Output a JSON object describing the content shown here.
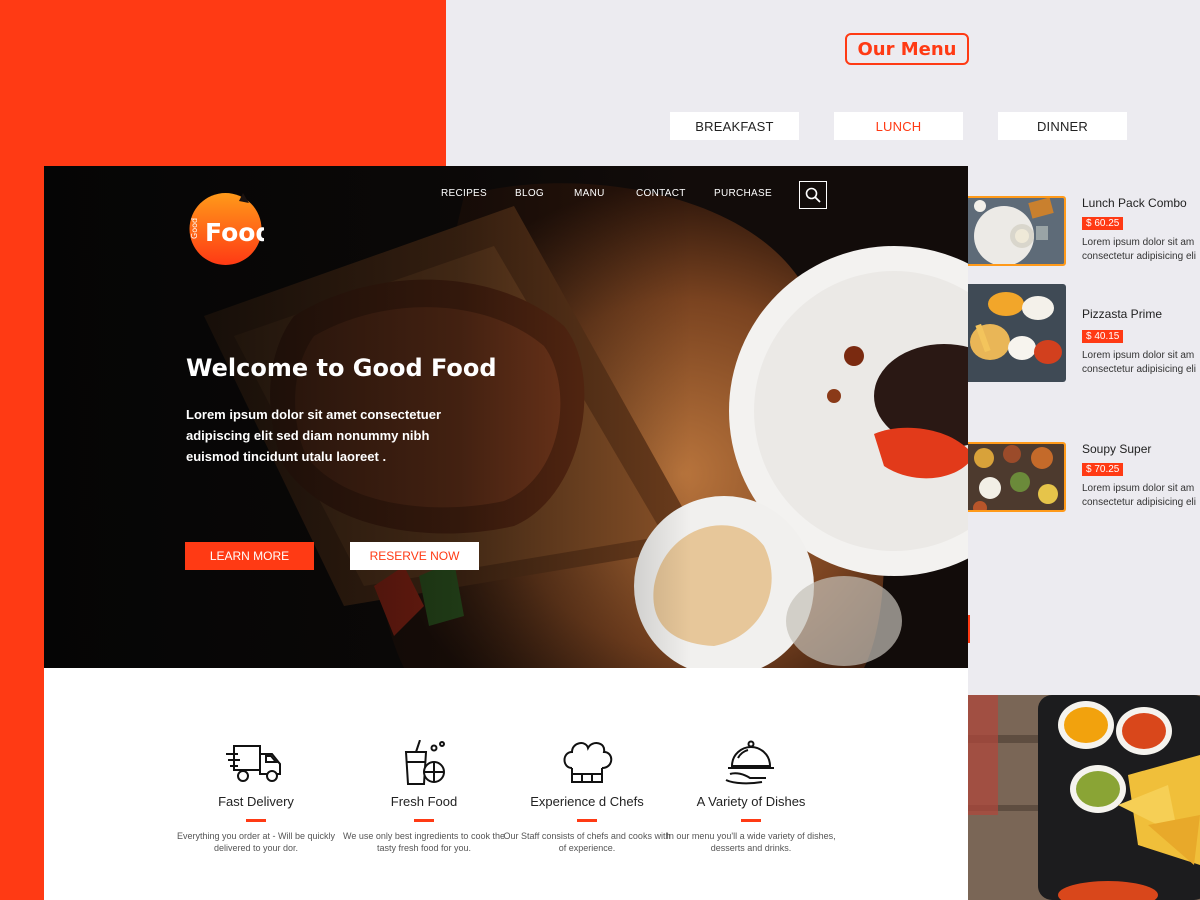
{
  "menu_section": {
    "title": "Our Menu",
    "tabs": [
      {
        "label": "BREAKFAST",
        "active": false
      },
      {
        "label": "LUNCH",
        "active": true
      },
      {
        "label": "DINNER",
        "active": false
      }
    ],
    "items": [
      {
        "name": "Lunch Pack Combo",
        "price": "$ 60.25",
        "desc1": "Lorem ipsum dolor sit am",
        "desc2": "consectetur adipisicing eli"
      },
      {
        "name": "Pizzasta Prime",
        "price": "$ 40.15",
        "desc1": "Lorem ipsum dolor sit am",
        "desc2": "consectetur adipisicing eli"
      },
      {
        "name": "Soupy Super",
        "price": "$ 70.25",
        "desc1": "Lorem ipsum dolor sit am",
        "desc2": "consectetur adipisicing eli"
      }
    ]
  },
  "header": {
    "logo_small": "Good",
    "logo_big": "Food",
    "nav": [
      "RECIPES",
      "BLOG",
      "MANU",
      "CONTACT",
      "PURCHASE"
    ]
  },
  "hero": {
    "title": "Welcome to Good Food",
    "text": "Lorem ipsum dolor sit amet consectetuer adipiscing elit sed diam nonummy nibh euismod tincidunt utalu laoreet .",
    "learn_more": "LEARN MORE",
    "reserve_now": "RESERVE NOW"
  },
  "features": [
    {
      "icon": "truck-icon",
      "title": "Fast Delivery",
      "desc": "Everything you order at - Will be quickly delivered to your dor."
    },
    {
      "icon": "fresh-drink-icon",
      "title": "Fresh Food",
      "desc": "We use only best ingredients to cook the tasty fresh food for you."
    },
    {
      "icon": "chef-hat-icon",
      "title": "Experience d Chefs",
      "desc": "Our Staff consists of chefs and cooks with of experience."
    },
    {
      "icon": "serving-dish-icon",
      "title": "A Variety of Dishes",
      "desc": "In our menu you'll a wide variety of dishes, desserts and drinks."
    }
  ],
  "colors": {
    "accent": "#ff3a14",
    "thumb_border": "#ff9a1a",
    "background": "#ecebf0"
  }
}
